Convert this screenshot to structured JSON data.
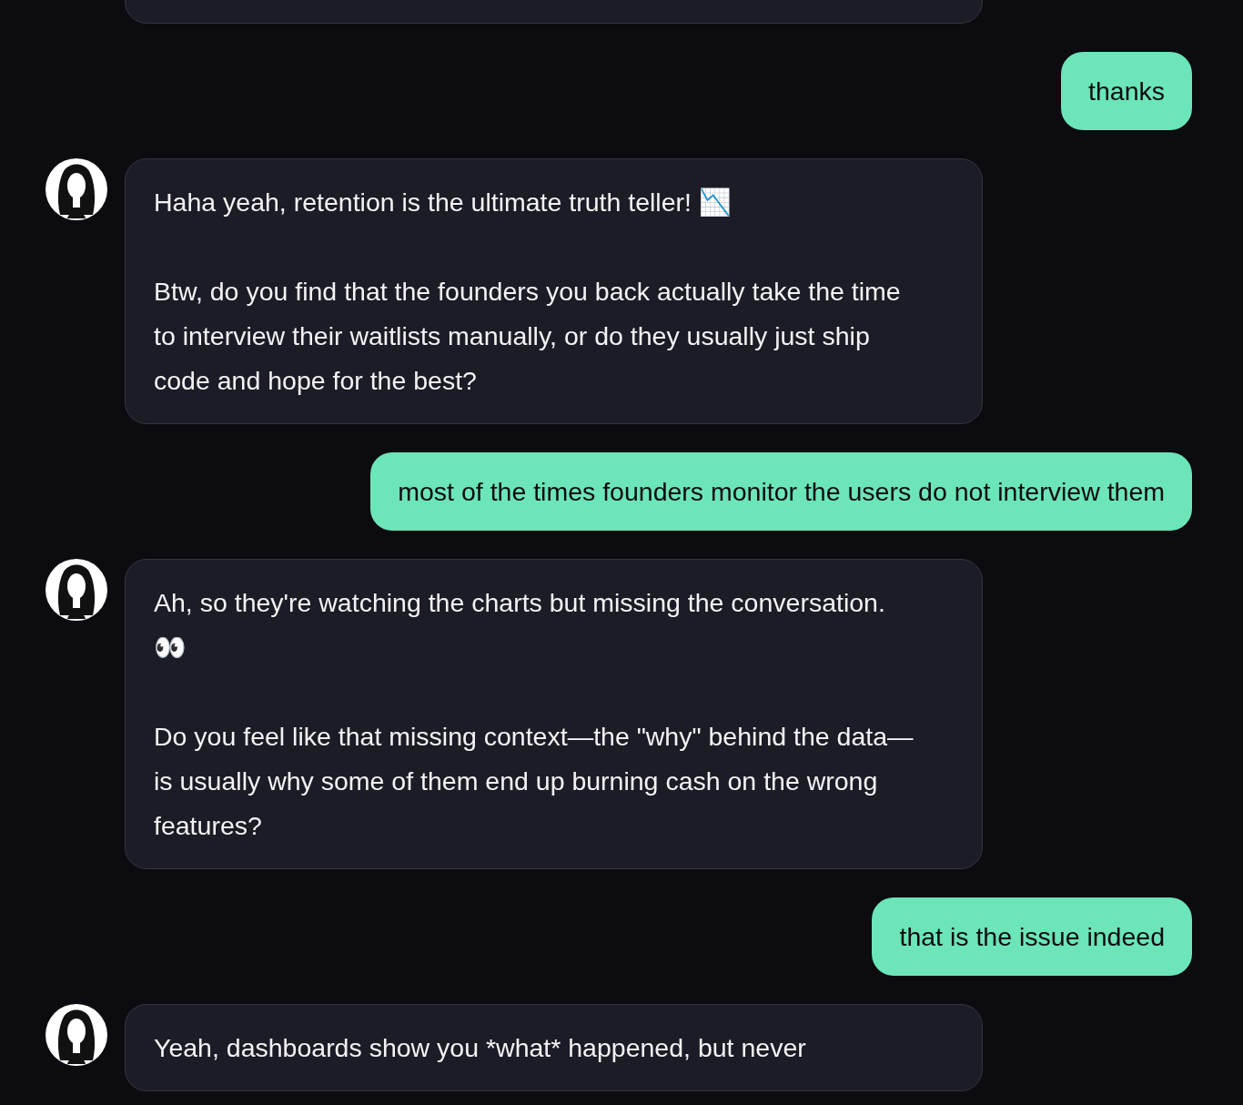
{
  "messages": [
    {
      "kind": "bot"
    },
    {
      "kind": "user",
      "text": "thanks"
    },
    {
      "kind": "bot",
      "text": "Haha yeah, retention is the ultimate truth teller! 📉\n\nBtw, do you find that the founders you back actually take the time to interview their waitlists manually, or do they usually just ship code and hope for the best?"
    },
    {
      "kind": "user",
      "text": "most of the times founders monitor the users do not interview them"
    },
    {
      "kind": "bot",
      "text": "Ah, so they're watching the charts but missing the conversation. 👀\n\nDo you feel like that missing context—the \"why\" behind the data—is usually why some of them end up burning cash on the wrong features?"
    },
    {
      "kind": "user",
      "text": "that is the issue indeed"
    },
    {
      "kind": "bot",
      "text": "Yeah, dashboards show you *what* happened, but never"
    }
  ]
}
